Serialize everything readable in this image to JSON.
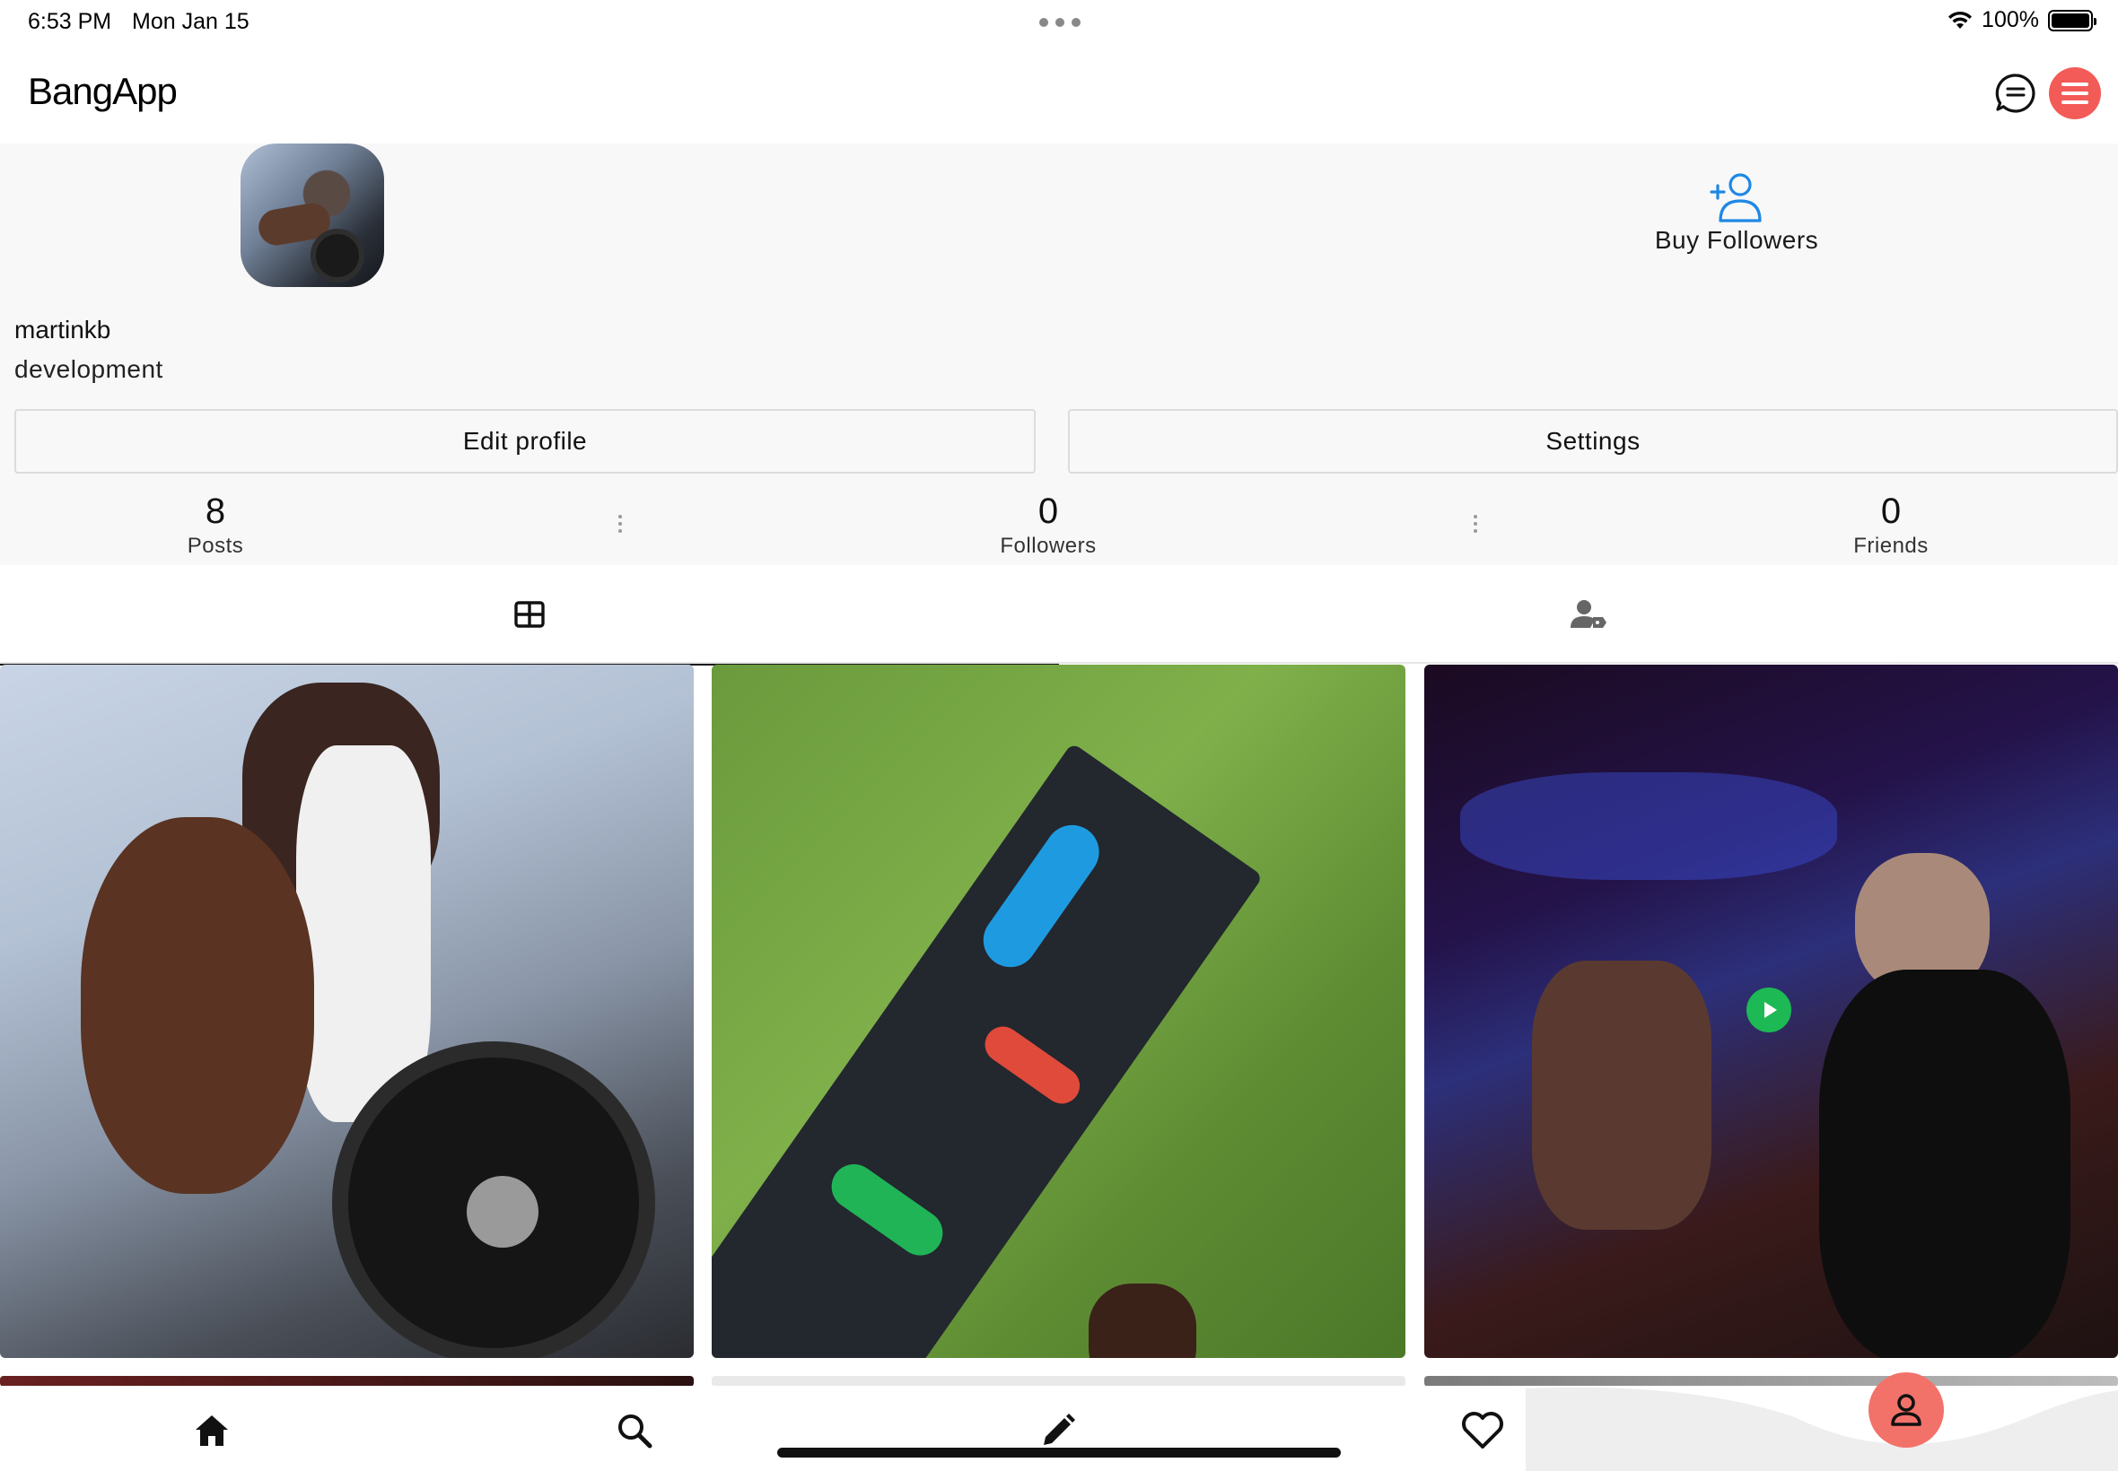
{
  "status_bar": {
    "time": "6:53 PM",
    "date": "Mon Jan 15",
    "battery": "100%"
  },
  "header": {
    "title": "BangApp",
    "accent_color": "#f25b57"
  },
  "profile": {
    "username": "martinkb",
    "bio": "development",
    "buy_followers_label": "Buy Followers",
    "edit_profile_label": "Edit profile",
    "settings_label": "Settings",
    "stats": {
      "posts_value": "8",
      "posts_label": "Posts",
      "followers_value": "0",
      "followers_label": "Followers",
      "friends_value": "0",
      "friends_label": "Friends"
    }
  },
  "tabs": [
    {
      "icon": "grid-icon",
      "active": true
    },
    {
      "icon": "tagged-user-icon",
      "active": false
    }
  ],
  "posts": [
    {
      "kind": "image",
      "subject": "gym-weight-plate"
    },
    {
      "kind": "image",
      "subject": "pushup-board-on-grass"
    },
    {
      "kind": "video",
      "subject": "dancing-woman-club"
    }
  ],
  "bottom_nav": {
    "items": [
      "home-icon",
      "search-icon",
      "pencil-icon",
      "heart-icon",
      "profile-icon"
    ],
    "active_color": "#f2726a"
  }
}
